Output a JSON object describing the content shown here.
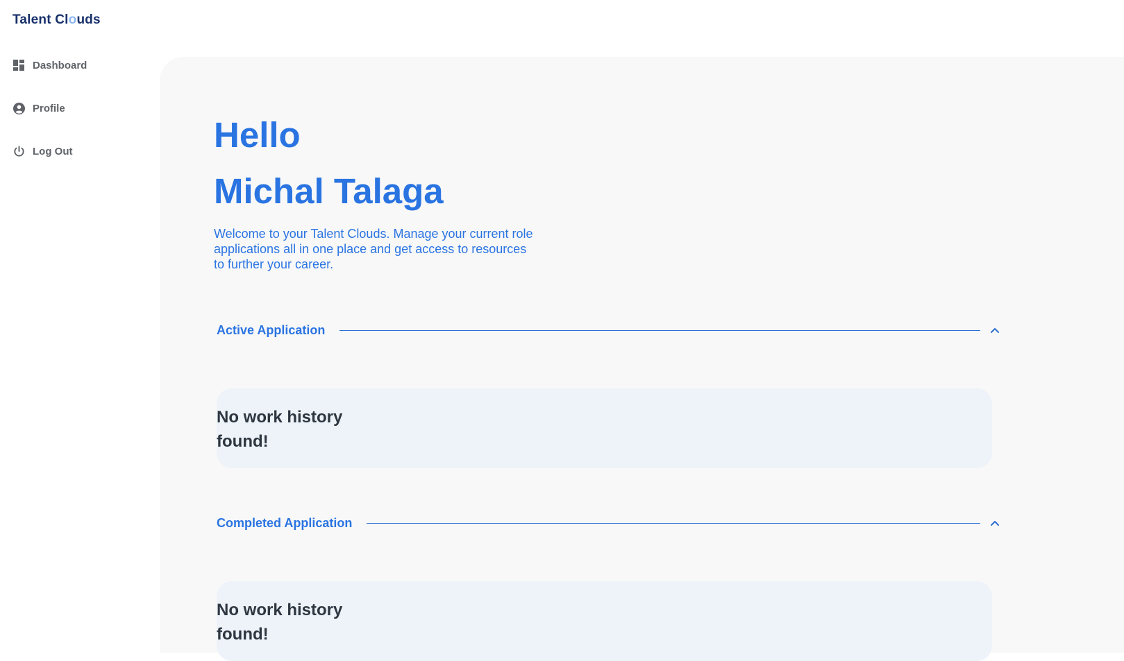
{
  "app": {
    "logo_part1": "Talent Cl",
    "logo_accent": "o",
    "logo_part2": "uds"
  },
  "sidebar": {
    "items": [
      {
        "label": "Dashboard",
        "icon": "dashboard-icon"
      },
      {
        "label": "Profile",
        "icon": "account-circle-icon"
      },
      {
        "label": "Log Out",
        "icon": "power-icon"
      }
    ]
  },
  "main": {
    "greeting_line1": "Hello",
    "greeting_line2": "Michal Talaga",
    "welcome": "Welcome to your Talent Clouds. Manage your current role applications all in one place and get access to resources to further your career.",
    "sections": [
      {
        "title": "Active Application",
        "empty_message": "No work history found!"
      },
      {
        "title": "Completed Application",
        "empty_message": "No work history found!"
      }
    ]
  },
  "colors": {
    "accent": "#2a74e2",
    "logo": "#17306b",
    "sidebar_text": "#5f6368",
    "main_bg": "#f8f8f8",
    "card_bg": "#eef3fa"
  }
}
